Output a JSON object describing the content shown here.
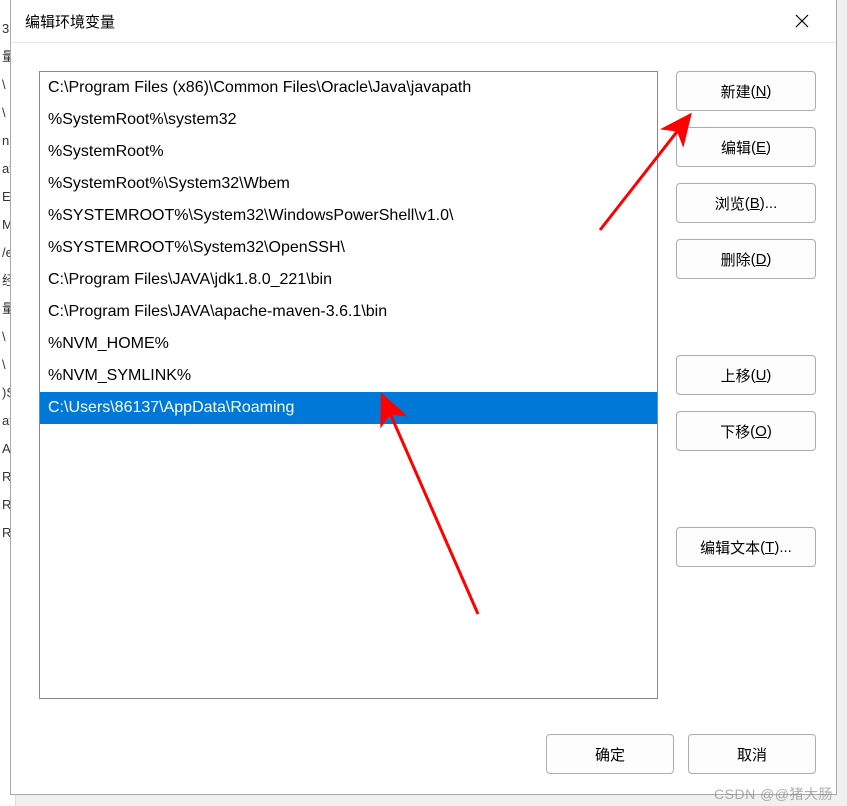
{
  "bgLetters": [
    "3",
    "量",
    "\\",
    "\\",
    "n",
    "at",
    "El",
    "M",
    "/e",
    "",
    "",
    "经",
    "量",
    "\\",
    "\\",
    ")S",
    "at",
    "A",
    "R",
    "R",
    "R"
  ],
  "dialog": {
    "title": "编辑环境变量"
  },
  "list": {
    "items": [
      "C:\\Program Files (x86)\\Common Files\\Oracle\\Java\\javapath",
      "%SystemRoot%\\system32",
      "%SystemRoot%",
      "%SystemRoot%\\System32\\Wbem",
      "%SYSTEMROOT%\\System32\\WindowsPowerShell\\v1.0\\",
      "%SYSTEMROOT%\\System32\\OpenSSH\\",
      "C:\\Program Files\\JAVA\\jdk1.8.0_221\\bin",
      "C:\\Program Files\\JAVA\\apache-maven-3.6.1\\bin",
      "%NVM_HOME%",
      "%NVM_SYMLINK%",
      "C:\\Users\\86137\\AppData\\Roaming"
    ],
    "selectedIndex": 10
  },
  "buttons": {
    "new_label": "新建",
    "new_accel": "N",
    "edit_label": "编辑",
    "edit_accel": "E",
    "browse_label": "浏览",
    "browse_accel": "B",
    "browse_suffix": "...",
    "delete_label": "删除",
    "delete_accel": "D",
    "moveup_label": "上移",
    "moveup_accel": "U",
    "movedown_label": "下移",
    "movedown_accel": "O",
    "edittext_label": "编辑文本",
    "edittext_accel": "T",
    "edittext_suffix": "...",
    "ok_label": "确定",
    "cancel_label": "取消"
  },
  "watermark": "CSDN @@猪大肠"
}
